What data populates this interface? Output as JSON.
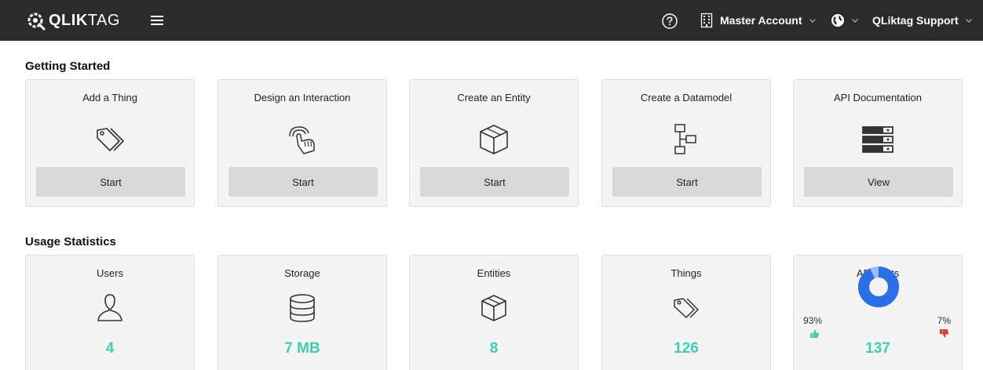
{
  "app": {
    "logo_bold": "QLIK",
    "logo_light": "TAG",
    "account_label": "Master Account",
    "user_label": "QLiktag Support"
  },
  "getting_started": {
    "title": "Getting Started",
    "cards": [
      {
        "title": "Add a Thing",
        "button": "Start",
        "icon": "tags-icon"
      },
      {
        "title": "Design an Interaction",
        "button": "Start",
        "icon": "tap-hand-icon"
      },
      {
        "title": "Create an Entity",
        "button": "Start",
        "icon": "cube-icon"
      },
      {
        "title": "Create a Datamodel",
        "button": "Start",
        "icon": "datamodel-icon"
      },
      {
        "title": "API Documentation",
        "button": "View",
        "icon": "server-icon"
      }
    ]
  },
  "usage": {
    "title": "Usage Statistics",
    "cards": [
      {
        "title": "Users",
        "value": "4",
        "icon": "user-icon"
      },
      {
        "title": "Storage",
        "value": "7 MB",
        "icon": "database-icon"
      },
      {
        "title": "Entities",
        "value": "8",
        "icon": "cube-icon"
      },
      {
        "title": "Things",
        "value": "126",
        "icon": "tags-icon"
      }
    ],
    "api": {
      "title": "API Stats",
      "value": "137",
      "success_pct": "93%",
      "fail_pct": "7%",
      "success_fraction": 0.93
    }
  },
  "colors": {
    "topbar": "#2b2b2b",
    "accent_teal": "#3ecfb2",
    "donut_blue": "#2a6ee8",
    "donut_light": "#9dbcf3",
    "thumb_down": "#e03a3a"
  }
}
